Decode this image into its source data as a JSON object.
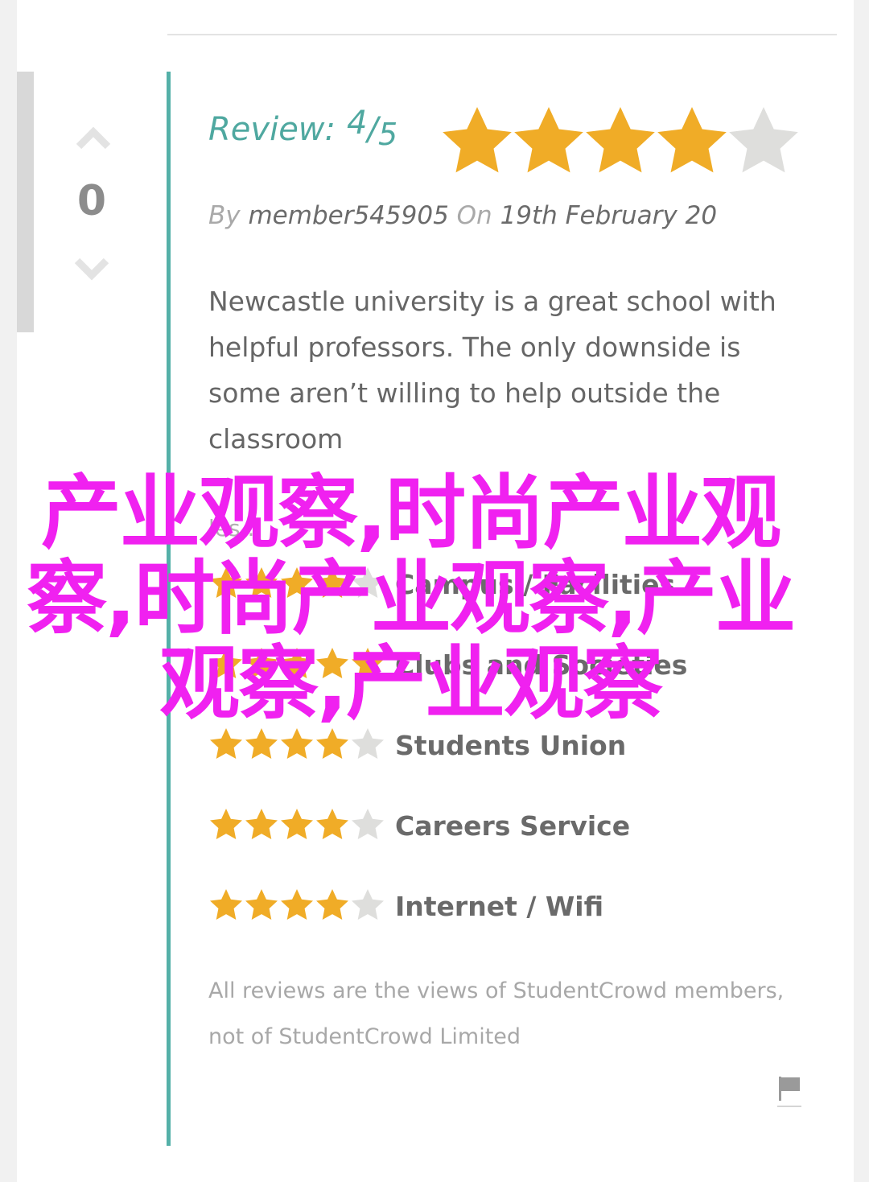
{
  "vote": {
    "count": "0"
  },
  "review": {
    "label": "Review:",
    "score": "4",
    "slash": "/",
    "max": "5",
    "rating": 4,
    "author_prefix": "By",
    "author": "member545905",
    "date_prefix": "On",
    "date": "19th February 20",
    "text": "Newcastle university is a great school with helpful professors. The only downside is some aren’t willing to help outside the classroom",
    "more": "les..."
  },
  "categories": [
    {
      "label": "Campus / Facilities",
      "rating": 4
    },
    {
      "label": "Clubs and Societies",
      "rating": 5
    },
    {
      "label": "Students Union",
      "rating": 4
    },
    {
      "label": "Careers Service",
      "rating": 4
    },
    {
      "label": "Internet / Wifi",
      "rating": 4
    }
  ],
  "disclaimer": "All reviews are the views of StudentCrowd members, not of StudentCrowd Limited",
  "watermark": "产业观察,时尚产业观察,时尚产业观察,产业观察,产业观察",
  "colors": {
    "accent": "#4fa8a0",
    "star_filled": "#f0ac27",
    "star_empty": "#dededc",
    "watermark": "#f021f0"
  },
  "icons": {
    "vote_up": "chevron-up-icon",
    "vote_down": "chevron-down-icon",
    "flag": "flag-icon",
    "star": "star-icon"
  }
}
